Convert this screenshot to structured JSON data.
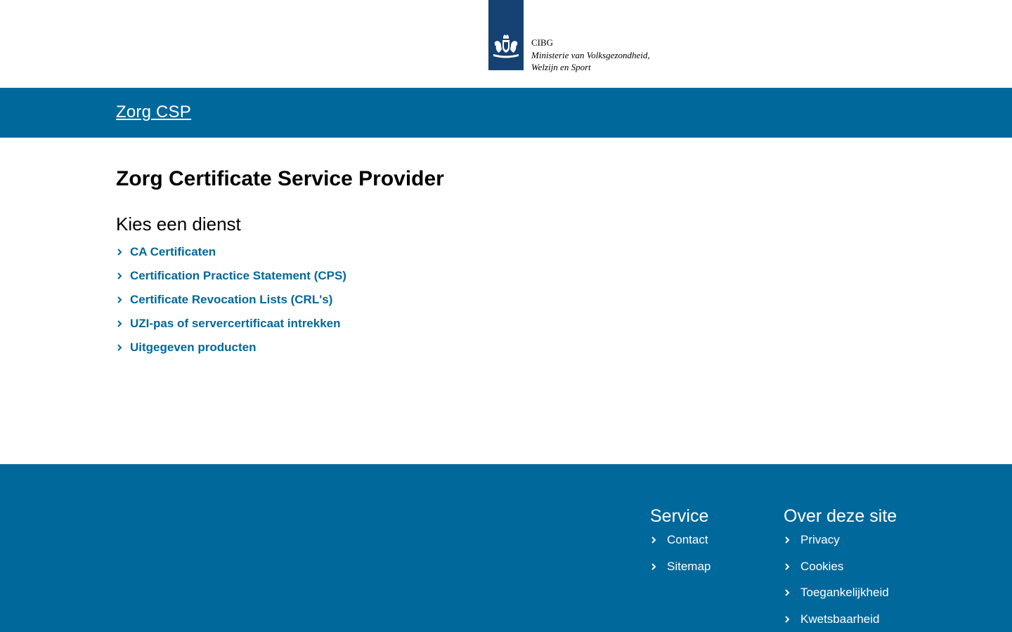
{
  "logo": {
    "emblem_icon": "royal-coat-of-arms-icon",
    "organization": "CIBG",
    "ministry_line1": "Ministerie van Volksgezondheid,",
    "ministry_line2": "Welzijn en Sport"
  },
  "site": {
    "name": "Zorg CSP"
  },
  "main": {
    "title": "Zorg Certificate Service Provider",
    "section_title": "Kies een dienst",
    "services": [
      {
        "label": "CA Certificaten"
      },
      {
        "label": "Certification Practice Statement (CPS)"
      },
      {
        "label": "Certificate Revocation Lists (CRL's)"
      },
      {
        "label": "UZI-pas of servercertificaat intrekken"
      },
      {
        "label": "Uitgegeven producten"
      }
    ]
  },
  "footer": {
    "service": {
      "title": "Service",
      "items": [
        {
          "label": "Contact"
        },
        {
          "label": "Sitemap"
        }
      ]
    },
    "about": {
      "title": "Over deze site",
      "items": [
        {
          "label": "Privacy"
        },
        {
          "label": "Cookies"
        },
        {
          "label": "Toegankelijkheid"
        },
        {
          "label": "Kwetsbaarheid"
        }
      ]
    }
  },
  "colors": {
    "brand_blue": "#01689b",
    "logo_blue": "#154273",
    "text": "#000000",
    "on_brand": "#ffffff"
  }
}
